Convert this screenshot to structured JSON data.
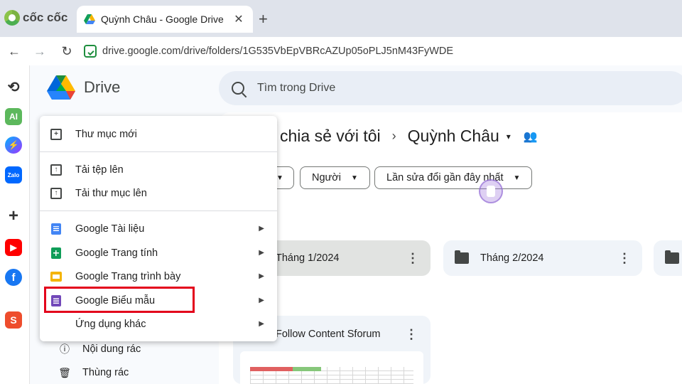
{
  "browser": {
    "brand": "cốc cốc",
    "tab_title": "Quỳnh Châu - Google Drive",
    "tab_close": "✕",
    "new_tab": "+",
    "url": "drive.google.com/drive/folders/1G535VbEpVBRcAZUp05oPLJ5nM43FyWDE"
  },
  "sidepanel": {
    "ai_label": "AI",
    "zalo_label": "Zalo",
    "shopee_label": "S"
  },
  "drive": {
    "product_name": "Drive",
    "search_placeholder": "Tìm trong Drive",
    "breadcrumb": {
      "prefix": "chia sẻ với tôi",
      "separator": "›",
      "current": "Quỳnh Châu",
      "caret": "▾"
    },
    "filters": [
      {
        "label": "Người"
      },
      {
        "label": "Lần sửa đổi gần đây nhất"
      }
    ],
    "folders": [
      {
        "name": "Tháng 1/2024"
      },
      {
        "name": "Tháng 2/2024"
      }
    ],
    "file_card": {
      "title": "Follow Content Sforum"
    },
    "left_nav": [
      {
        "label": "Nội dung rác"
      },
      {
        "label": "Thùng rác"
      }
    ]
  },
  "menu": {
    "items": [
      {
        "label": "Thư mục mới"
      },
      {
        "label": "Tải tệp lên"
      },
      {
        "label": "Tải thư mục lên"
      },
      {
        "label": "Google Tài liệu"
      },
      {
        "label": "Google Trang tính"
      },
      {
        "label": "Google Trang trình bày"
      },
      {
        "label": "Google Biểu mẫu"
      },
      {
        "label": "Ứng dụng khác"
      }
    ]
  },
  "colors": {
    "highlight": "#e3001b",
    "docs": "#4285f4",
    "sheets": "#0f9d58",
    "slides": "#f4b400",
    "forms": "#7248b9"
  }
}
